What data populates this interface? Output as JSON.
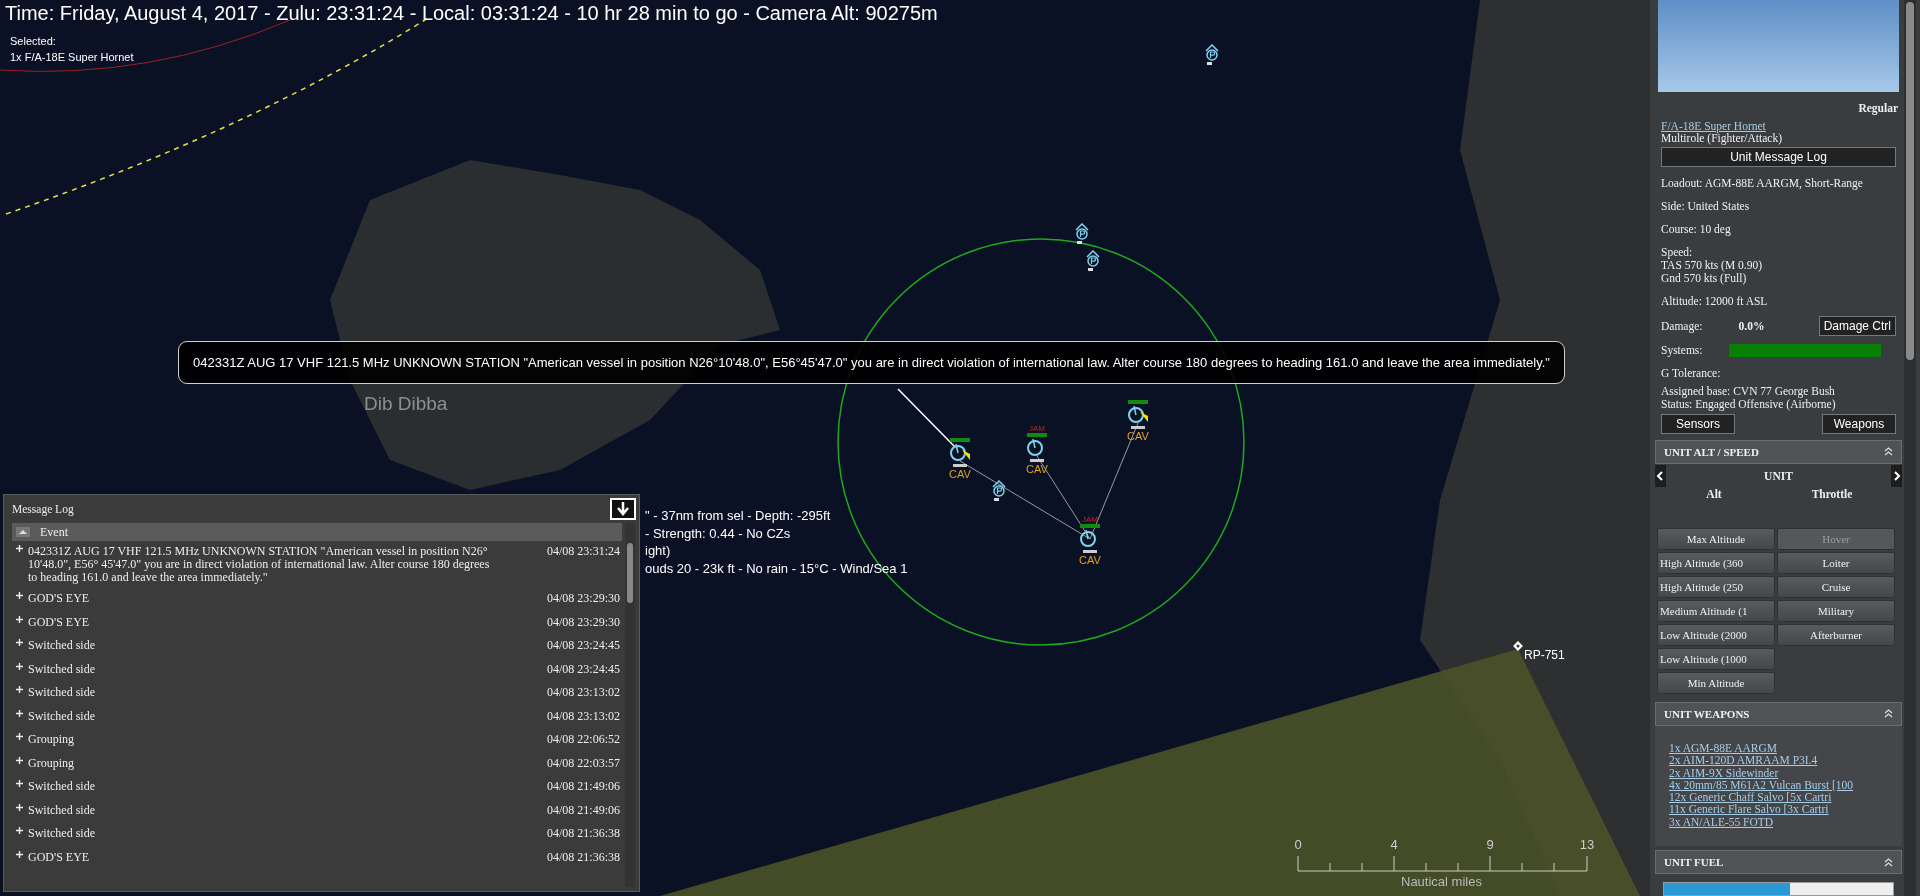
{
  "header": {
    "time_line": "Time: Friday, August 4, 2017 - Zulu: 23:31:24 - Local: 03:31:24 - 10 hr 28 min to go -  Camera Alt: 90275m",
    "selected_label": "Selected:",
    "selected_unit": "1x F/A-18E Super Hornet"
  },
  "map": {
    "place_label": "Dib Dibba",
    "units": [
      {
        "label": "CAV",
        "weapon_marker": true
      },
      {
        "label": "CAV",
        "tag": "JAM",
        "weapon_marker": false
      },
      {
        "label": "CAV",
        "weapon_marker": true
      },
      {
        "label": "CAV",
        "tag": "JAM",
        "weapon_marker": false
      }
    ],
    "reference_point": "RP-751",
    "readouts": [
      "\" - 37nm from sel - Depth: -295ft",
      "- Strength: 0.44 - No CZs",
      "ight)",
      "ouds 20 - 23k ft - No rain - 15°C - Wind/Sea 1"
    ],
    "scale_bar": {
      "ticks": [
        "0",
        "4",
        "9",
        "13"
      ],
      "unit": "Nautical miles"
    }
  },
  "tooltip": {
    "text": "042331Z AUG 17 VHF 121.5 MHz UNKNOWN STATION \"American vessel in position N26°10'48.0\", E56°45'47.0\" you are in direct violation of international law. Alter course 180 degrees to heading 161.0 and leave the area immediately.\""
  },
  "message_log": {
    "title": "Message Log",
    "column": "Event",
    "rows": [
      {
        "event": "042331Z AUG 17 VHF 121.5 MHz UNKNOWN STATION \"American vessel in position N26° 10'48.0\", E56° 45'47.0\" you are in direct violation of international law. Alter course 180 degrees to heading 161.0 and leave the area immediately.\"",
        "time": "04/08 23:31:24"
      },
      {
        "event": "GOD'S EYE",
        "time": "04/08 23:29:30"
      },
      {
        "event": "GOD'S EYE",
        "time": "04/08 23:29:30"
      },
      {
        "event": "Switched side",
        "time": "04/08 23:24:45"
      },
      {
        "event": "Switched side",
        "time": "04/08 23:24:45"
      },
      {
        "event": "Switched side",
        "time": "04/08 23:13:02"
      },
      {
        "event": "Switched side",
        "time": "04/08 23:13:02"
      },
      {
        "event": "Grouping",
        "time": "04/08 22:06:52"
      },
      {
        "event": "Grouping",
        "time": "04/08 22:03:57"
      },
      {
        "event": "Switched side",
        "time": "04/08 21:49:06"
      },
      {
        "event": "Switched side",
        "time": "04/08 21:49:06"
      },
      {
        "event": "Switched side",
        "time": "04/08 21:36:38"
      },
      {
        "event": "GOD'S EYE",
        "time": "04/08 21:36:38"
      }
    ]
  },
  "unit_panel": {
    "proficiency": "Regular",
    "unit_name": "F/A-18E Super Hornet",
    "role": "Multirole (Fighter/Attack)",
    "message_log_button": "Unit Message Log",
    "info_blocks": [
      [
        "Loadout: AGM-88E AARGM, Short-Range"
      ],
      [
        "Side: United States"
      ],
      [
        "Course: 10 deg"
      ],
      [
        "Speed:",
        "TAS 570 kts (M 0.90)",
        "Gnd 570 kts (Full)"
      ],
      [
        "Altitude: 12000 ft ASL"
      ]
    ],
    "damage_label": "Damage:",
    "damage_value": "0.0%",
    "damage_button": "Damage Ctrl",
    "systems_label": "Systems:",
    "systems_bar": {
      "level": 1.0
    },
    "g_tolerance_label": "G Tolerance:",
    "status_lines": [
      "Assigned base: CVN 77 George Bush",
      "Status: Engaged Offensive (Airborne)"
    ],
    "buttons": [
      "Sensors",
      "Weapons"
    ],
    "alt_speed": {
      "title": "UNIT ALT / SPEED",
      "unit_label": "UNIT",
      "alt_heading": "Alt",
      "throttle_heading": "Throttle",
      "alt_buttons": [
        "Max Altitude",
        "High Altitude (360",
        "High Altitude (250",
        "Medium Altitude (1",
        "Low Altitude (2000",
        "Low Altitude (1000",
        "Min Altitude"
      ],
      "throttle_buttons": [
        {
          "label": "Hover",
          "disabled": true
        },
        {
          "label": "Loiter",
          "disabled": false
        },
        {
          "label": "Cruise",
          "disabled": false
        },
        {
          "label": "Military",
          "disabled": false
        },
        {
          "label": "Afterburner",
          "disabled": false
        }
      ]
    },
    "weapons": {
      "title": "UNIT WEAPONS",
      "items": [
        "1x AGM-88E AARGM",
        "2x AIM-120D AMRAAM P3I.4",
        "2x AIM-9X Sidewinder",
        "4x 20mm/85 M61A2 Vulcan Burst [100",
        "12x Generic Chaff Salvo [5x Cartri",
        "11x Generic Flare Salvo [3x Cartri",
        "3x AN/ALE-55 FOTD"
      ]
    },
    "fuel": {
      "title": "UNIT FUEL",
      "level": 0.55
    }
  }
}
